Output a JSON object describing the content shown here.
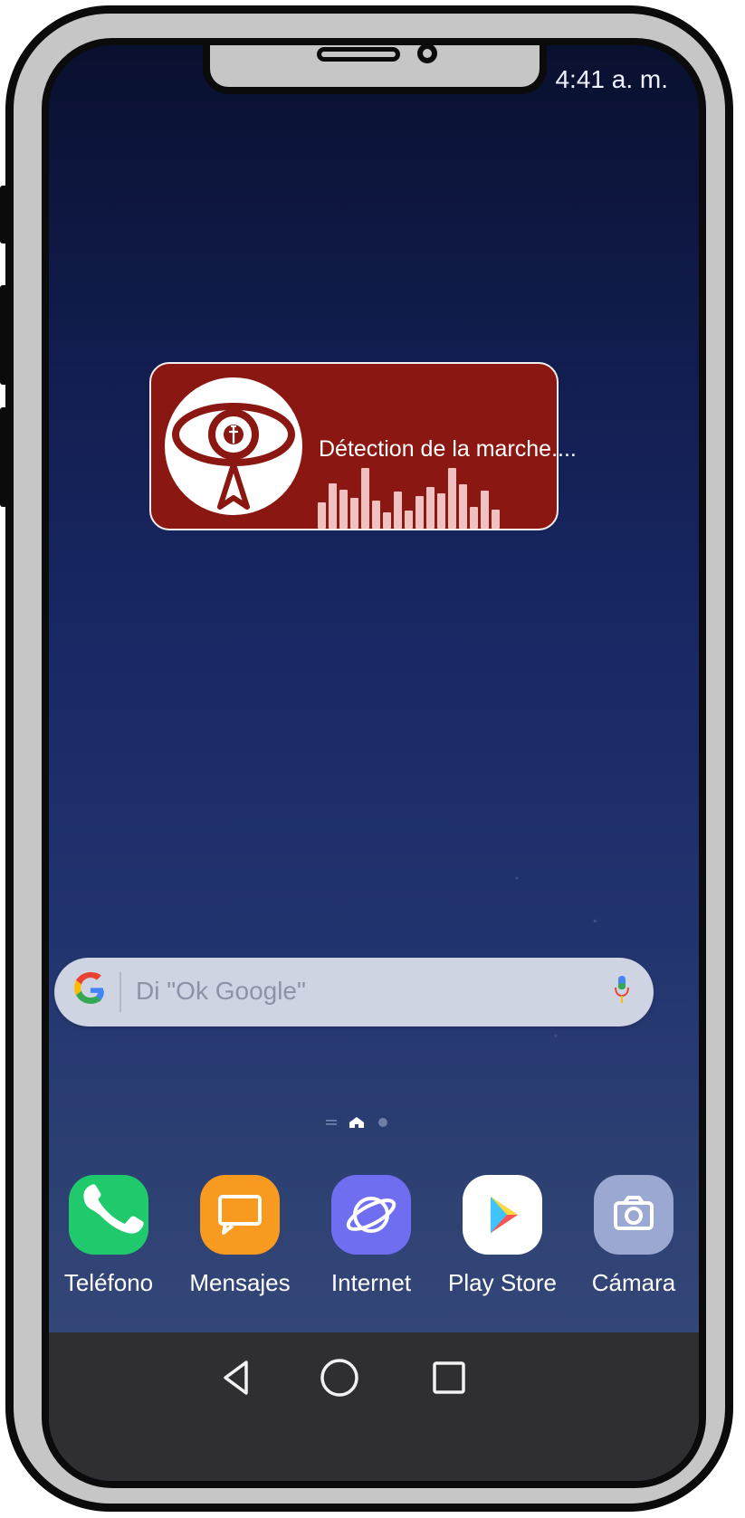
{
  "status_bar": {
    "time": "4:41 a. m."
  },
  "widget": {
    "label": "Détection de la marche....",
    "bar_levels": [
      0.42,
      0.72,
      0.62,
      0.48,
      0.95,
      0.44,
      0.26,
      0.58,
      0.28,
      0.52,
      0.66,
      0.56,
      0.96,
      0.7,
      0.34,
      0.6,
      0.3
    ]
  },
  "search": {
    "placeholder": "Di \"Ok Google\""
  },
  "dock": {
    "apps": [
      {
        "label": "Teléfono",
        "icon": "phone-icon",
        "color": "#20c96b"
      },
      {
        "label": "Mensajes",
        "icon": "message-icon",
        "color": "#f79a1f"
      },
      {
        "label": "Internet",
        "icon": "planet-icon",
        "color": "#6f6ef0"
      },
      {
        "label": "Play Store",
        "icon": "play-store-icon",
        "color": "#ffffff"
      },
      {
        "label": "Cámara",
        "icon": "camera-icon",
        "color": "#9ba9d2"
      }
    ]
  },
  "navigation": {
    "items": [
      "back-icon",
      "home-icon",
      "recent-apps-icon"
    ]
  },
  "colors": {
    "widget_background": "#8a1711",
    "widget_bars": "#efc1c1",
    "navbar_background": "#2f2f31",
    "search_background": "#cfd4e3"
  }
}
